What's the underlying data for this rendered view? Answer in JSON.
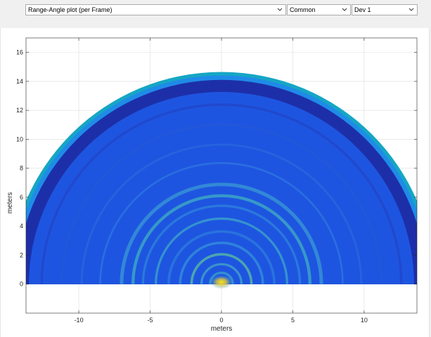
{
  "toolbar": {
    "plot_select": "Range-Angle plot (per Frame)",
    "mode_select": "Common",
    "device_select": "Dev 1"
  },
  "colors": {
    "deep": "#1d2fa8",
    "base": "#1e55e0",
    "mid": "#1f8be8",
    "cyan": "#16a6c4",
    "yellow": "#e8e020",
    "window_bg": "#f0f0f0"
  },
  "chart_data": {
    "type": "heatmap",
    "xlabel": "meters",
    "ylabel": "meters",
    "xlim": [
      -13.7,
      13.7
    ],
    "ylim": [
      -2,
      17
    ],
    "xticks": [
      "-10",
      "-5",
      "0",
      "5",
      "10"
    ],
    "xtick_values": [
      -10,
      -5,
      0,
      5,
      10
    ],
    "yticks": [
      "0",
      "2",
      "4",
      "6",
      "8",
      "10",
      "12",
      "14",
      "16"
    ],
    "ytick_values": [
      0,
      2,
      4,
      6,
      8,
      10,
      12,
      14,
      16
    ],
    "grid": true,
    "max_range": 14.9,
    "colormap": "parula"
  }
}
